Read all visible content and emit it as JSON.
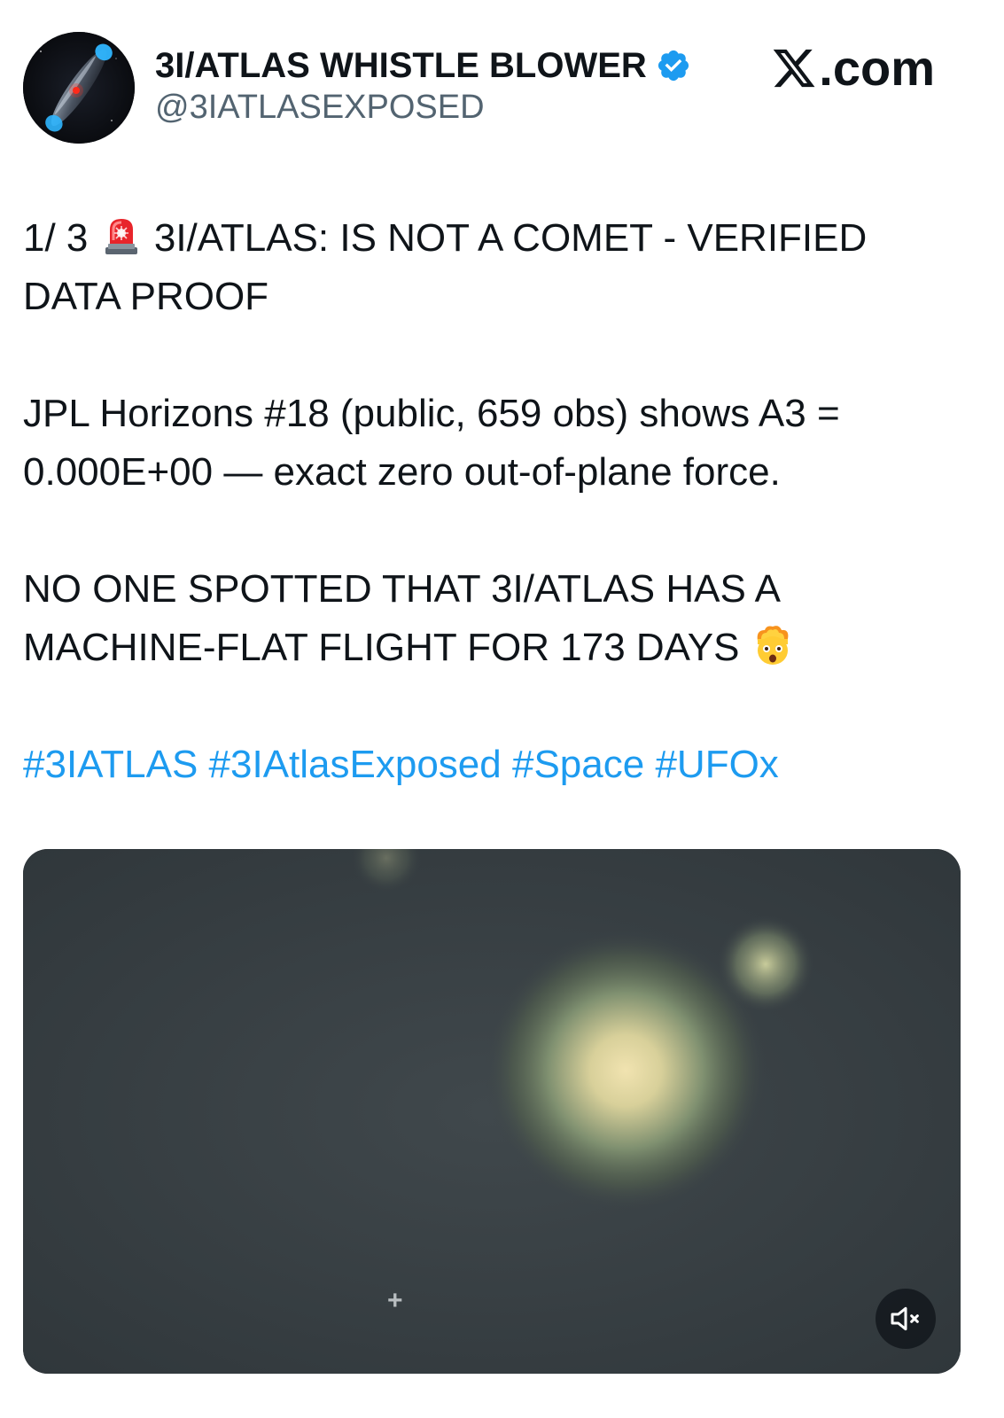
{
  "header": {
    "display_name": "3I/ATLAS WHISTLE BLOWER",
    "handle": "@3IATLASEXPOSED",
    "verified": true,
    "site_logo_text": ".com",
    "avatar_icon": "comet-avatar-icon",
    "verified_icon": "verified-badge-icon",
    "logo_icon": "x-logo-icon"
  },
  "tweet": {
    "line1_prefix": "1/ 3",
    "line1_emoji": "rotating-light-emoji",
    "line1_text": "3I/ATLAS: IS NOT A COMET - VERIFIED DATA PROOF",
    "paragraph2": "JPL Horizons #18 (public, 659 obs) shows A3 = 0.000E+00 — exact zero out-of-plane force.",
    "paragraph3_text": "NO ONE SPOTTED THAT 3I/ATLAS HAS A MACHINE-FLAT FLIGHT FOR 173 DAYS",
    "paragraph3_emoji": "exploding-head-emoji",
    "hashtags": [
      "#3IATLAS",
      "#3IAtlasExposed",
      "#Space",
      "#UFOx"
    ]
  },
  "media": {
    "type": "video",
    "crosshair": "+",
    "mute_icon": "speaker-muted-icon"
  },
  "colors": {
    "link": "#1d9bf0",
    "text": "#0f1419",
    "secondary_text": "#536471",
    "verified": "#1d9bf0",
    "media_background": "#3a4146"
  }
}
